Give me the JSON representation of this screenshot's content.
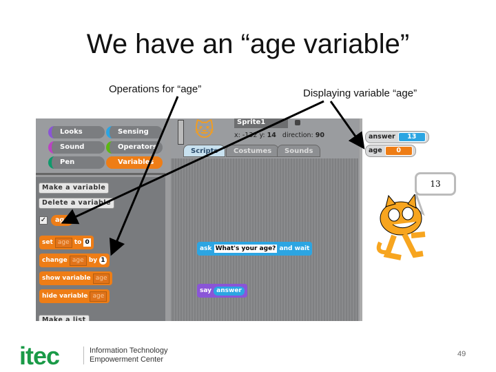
{
  "slide": {
    "title": "We have an “age variable”",
    "caption_left": "Operations for “age”",
    "caption_right": "Displaying variable “age”",
    "page_number": "49"
  },
  "logo": {
    "text": "itec",
    "org_line1": "Information Technology",
    "org_line2": "Empowerment Center",
    "color": "#1a9a47"
  },
  "categories": [
    {
      "label": "Looks",
      "color": "#8a55d7"
    },
    {
      "label": "Sensing",
      "color": "#2ca5e2"
    },
    {
      "label": "Sound",
      "color": "#bb42c3"
    },
    {
      "label": "Operators",
      "color": "#5cb712"
    },
    {
      "label": "Pen",
      "color": "#0e9a6c"
    },
    {
      "label": "Variables",
      "color": "#ee7d16",
      "selected": true
    }
  ],
  "palette": {
    "make_variable": "Make a variable",
    "delete_variable": "Delete a variable",
    "variable": "age",
    "checked": true,
    "set": {
      "a": "set",
      "var": "age",
      "b": "to",
      "val": "0"
    },
    "change": {
      "a": "change",
      "var": "age",
      "b": "by",
      "val": "1"
    },
    "show": {
      "a": "show variable",
      "var": "age"
    },
    "hide": {
      "a": "hide variable",
      "var": "age"
    },
    "make_list": "Make a list"
  },
  "sprite": {
    "name": "Sprite1",
    "x_label": "x:",
    "x": "-132",
    "y_label": "y:",
    "y": "14",
    "dir_label": "direction:",
    "dir": "90"
  },
  "tabs": [
    "Scripts",
    "Costumes",
    "Sounds"
  ],
  "scripts": {
    "ask": "ask",
    "ask_text": "What's your age?",
    "ask_wait": "and wait",
    "say": "say",
    "say_val": "answer"
  },
  "stage": {
    "monitors": [
      {
        "label": "answer",
        "value": "13",
        "color": "#2ca5e2"
      },
      {
        "label": "age",
        "value": "0",
        "color": "#ee7d16"
      }
    ],
    "bubble": "13"
  }
}
